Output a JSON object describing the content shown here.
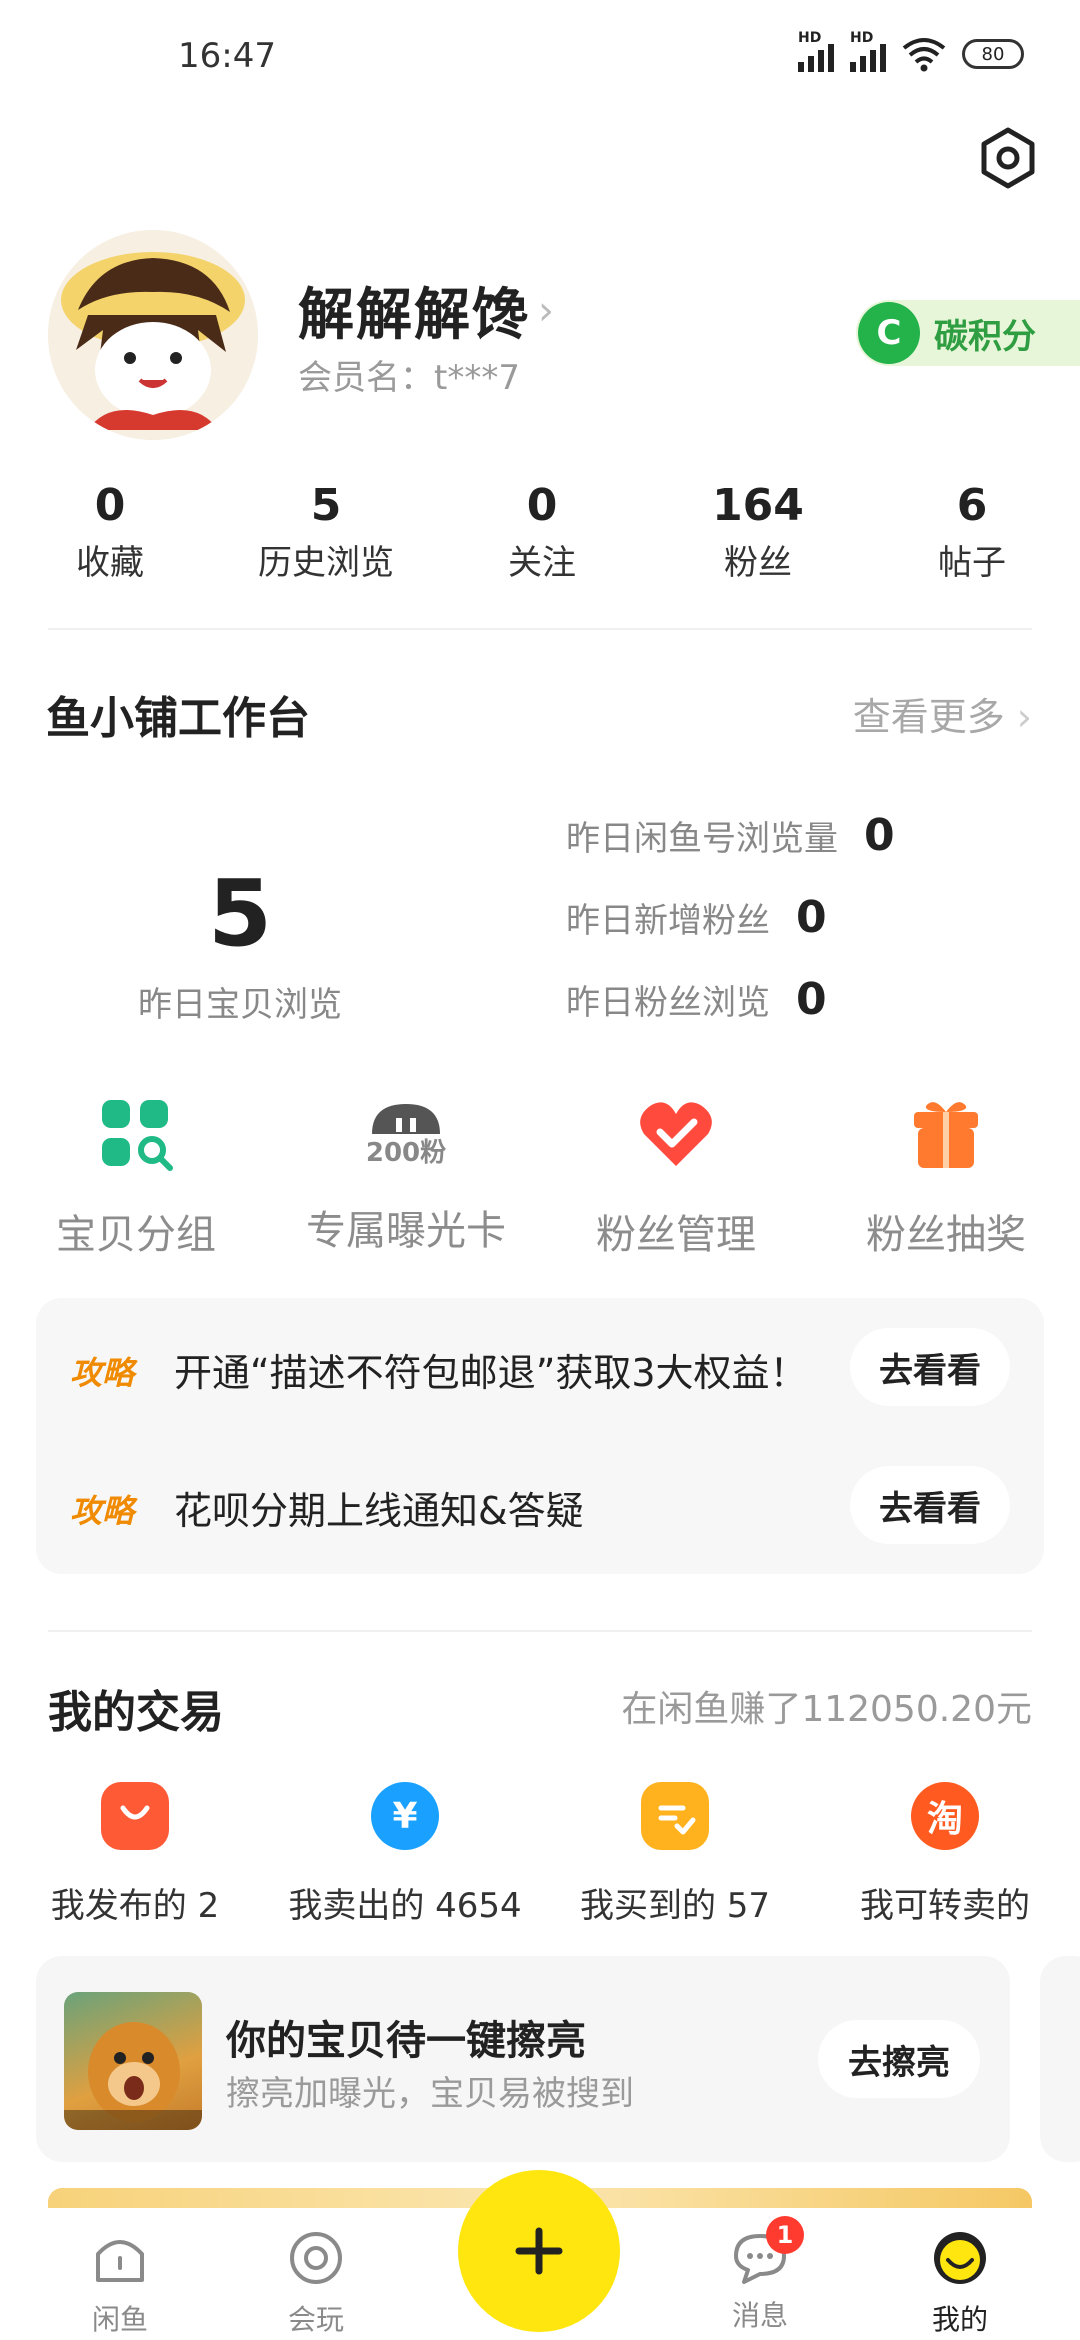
{
  "status_bar": {
    "time": "16:47",
    "battery": "80"
  },
  "profile": {
    "name": "解解解馋",
    "member_label": "会员名：t***7",
    "carbon_icon_letter": "C",
    "carbon_label": "碳积分",
    "avatar_icon": "cartoon-avatar"
  },
  "stats": [
    {
      "value": "0",
      "label": "收藏"
    },
    {
      "value": "5",
      "label": "历史浏览"
    },
    {
      "value": "0",
      "label": "关注"
    },
    {
      "value": "164",
      "label": "粉丝"
    },
    {
      "value": "6",
      "label": "帖子"
    }
  ],
  "workbench": {
    "title": "鱼小铺工作台",
    "more": "查看更多",
    "main_value": "5",
    "main_label": "昨日宝贝浏览",
    "metrics": [
      {
        "label": "昨日闲鱼号浏览量",
        "value": "0"
      },
      {
        "label": "昨日新增粉丝",
        "value": "0"
      },
      {
        "label": "昨日粉丝浏览",
        "value": "0"
      }
    ],
    "tools": [
      {
        "label": "宝贝分组",
        "icon": "grid-search-icon"
      },
      {
        "label": "专属曝光卡",
        "icon": "exposure-card-icon",
        "badge": "200粉"
      },
      {
        "label": "粉丝管理",
        "icon": "heart-check-icon"
      },
      {
        "label": "粉丝抽奖",
        "icon": "gift-icon"
      }
    ]
  },
  "tips": [
    {
      "tag": "攻略",
      "text": "开通“描述不符包邮退”获取3大权益！",
      "button": "去看看"
    },
    {
      "tag": "攻略",
      "text": "花呗分期上线通知&答疑",
      "button": "去看看"
    }
  ],
  "trade": {
    "title": "我的交易",
    "earned": "在闲鱼赚了112050.20元",
    "items": [
      {
        "label": "我发布的 2",
        "icon": "bag-icon",
        "color": "#ff5a36"
      },
      {
        "label": "我卖出的 4654",
        "icon": "yen-icon",
        "color": "#1aa1ff"
      },
      {
        "label": "我买到的 57",
        "icon": "checklist-icon",
        "color": "#ffb21e"
      },
      {
        "label": "我可转卖的",
        "icon": "taobao-icon",
        "color": "#ff5a1f",
        "glyph": "淘"
      }
    ]
  },
  "promo": {
    "title": "你的宝贝待一键擦亮",
    "subtitle": "擦亮加曝光，宝贝易被搜到",
    "button": "去擦亮"
  },
  "tabbar": {
    "items": [
      {
        "label": "闲鱼",
        "icon": "home-icon"
      },
      {
        "label": "会玩",
        "icon": "play-circle-icon"
      },
      {
        "label": "消息",
        "icon": "message-icon",
        "badge": "1"
      },
      {
        "label": "我的",
        "icon": "smile-icon",
        "active": true
      }
    ],
    "publish_icon": "plus-icon"
  },
  "colors": {
    "accent": "#ffe60f",
    "carbon_green": "#24b24b",
    "tip_orange": "#f08a00"
  }
}
